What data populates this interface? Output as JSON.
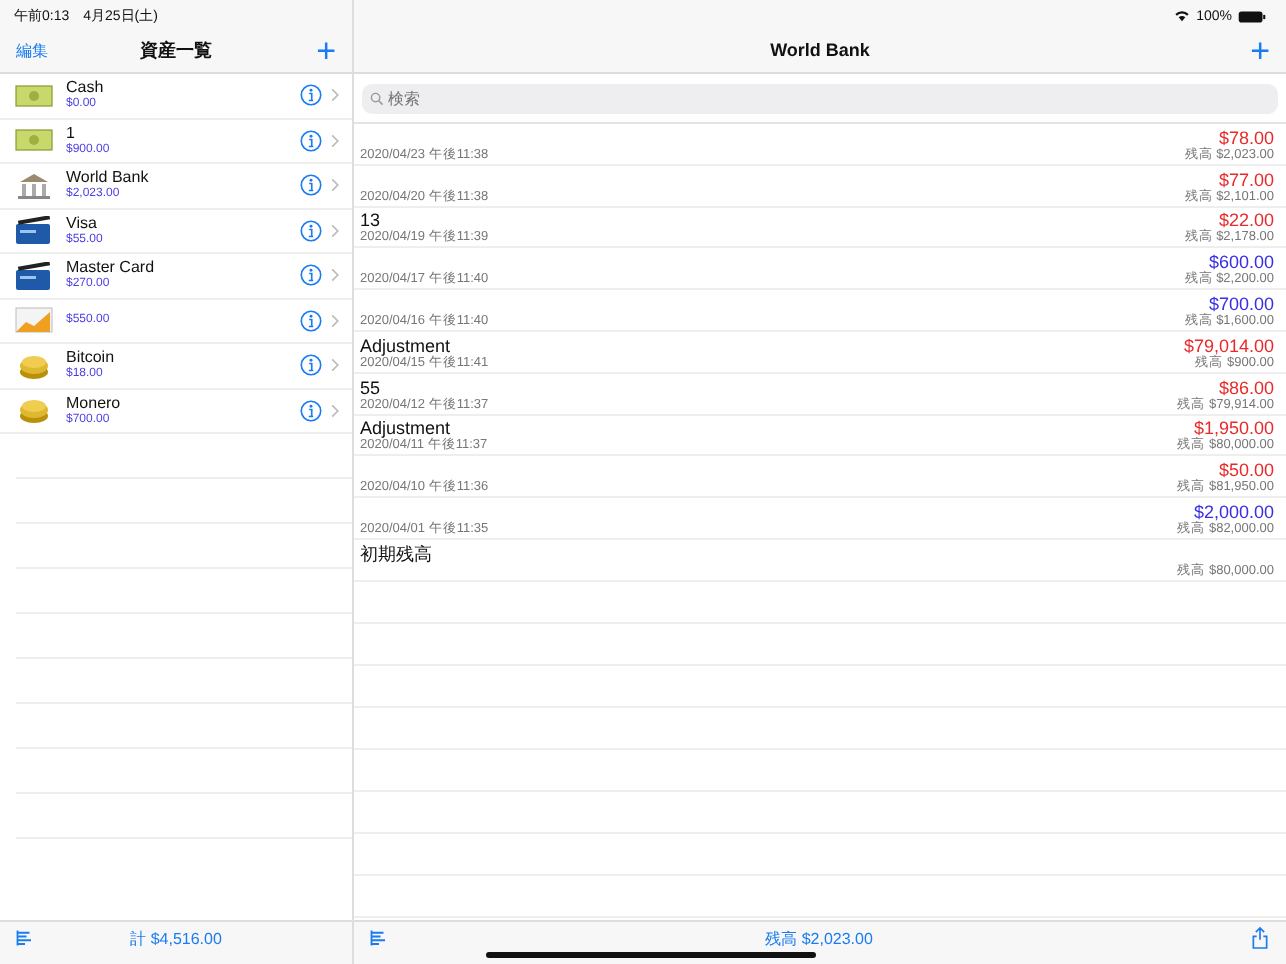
{
  "status_bar": {
    "time": "午前0:13　4月25日(土)",
    "battery": "100%"
  },
  "sidebar": {
    "edit": "編集",
    "title": "資産一覧",
    "add": "+",
    "items": [
      {
        "kind": "cash",
        "name": "Cash",
        "value": "$0.00"
      },
      {
        "kind": "cash",
        "name": "1",
        "value": "$900.00"
      },
      {
        "kind": "bank",
        "name": "World Bank",
        "value": "$2,023.00"
      },
      {
        "kind": "card",
        "name": "Visa",
        "value": "$55.00"
      },
      {
        "kind": "card",
        "name": "Master Card",
        "value": "$270.00"
      },
      {
        "kind": "chart",
        "value": "$550.00"
      },
      {
        "kind": "coin",
        "name": "Bitcoin",
        "value": "$18.00"
      },
      {
        "kind": "coin",
        "name": "Monero",
        "value": "$700.00"
      }
    ],
    "total": "計 $4,516.00"
  },
  "detail": {
    "title": "World Bank",
    "add": "+",
    "search": {
      "placeholder": "検索"
    },
    "transactions": [
      {
        "kind": "expense",
        "amount": "$78.00",
        "date": "2020/04/23 午後11:38",
        "balance": "残高 $2,023.00"
      },
      {
        "kind": "expense",
        "amount": "$77.00",
        "date": "2020/04/20 午後11:38",
        "balance": "残高 $2,101.00"
      },
      {
        "kind": "expense",
        "memo": "13",
        "amount": "$22.00",
        "date": "2020/04/19 午後11:39",
        "balance": "残高 $2,178.00"
      },
      {
        "kind": "income",
        "amount": "$600.00",
        "date": "2020/04/17 午後11:40",
        "balance": "残高 $2,200.00"
      },
      {
        "kind": "income",
        "amount": "$700.00",
        "date": "2020/04/16 午後11:40",
        "balance": "残高 $1,600.00"
      },
      {
        "kind": "expense",
        "memo": "Adjustment",
        "amount": "$79,014.00",
        "date": "2020/04/15 午後11:41",
        "balance": "残高 $900.00"
      },
      {
        "kind": "expense",
        "memo": "55",
        "amount": "$86.00",
        "date": "2020/04/12 午後11:37",
        "balance": "残高 $79,914.00"
      },
      {
        "kind": "expense",
        "memo": "Adjustment",
        "amount": "$1,950.00",
        "date": "2020/04/11 午後11:37",
        "balance": "残高 $80,000.00"
      },
      {
        "kind": "expense",
        "amount": "$50.00",
        "date": "2020/04/10 午後11:36",
        "balance": "残高 $81,950.00"
      },
      {
        "kind": "income",
        "amount": "$2,000.00",
        "date": "2020/04/01 午後11:35",
        "balance": "残高 $82,000.00"
      },
      {
        "memo": "初期残高",
        "balance": "残高 $80,000.00"
      }
    ],
    "balance": "残高 $2,023.00"
  }
}
